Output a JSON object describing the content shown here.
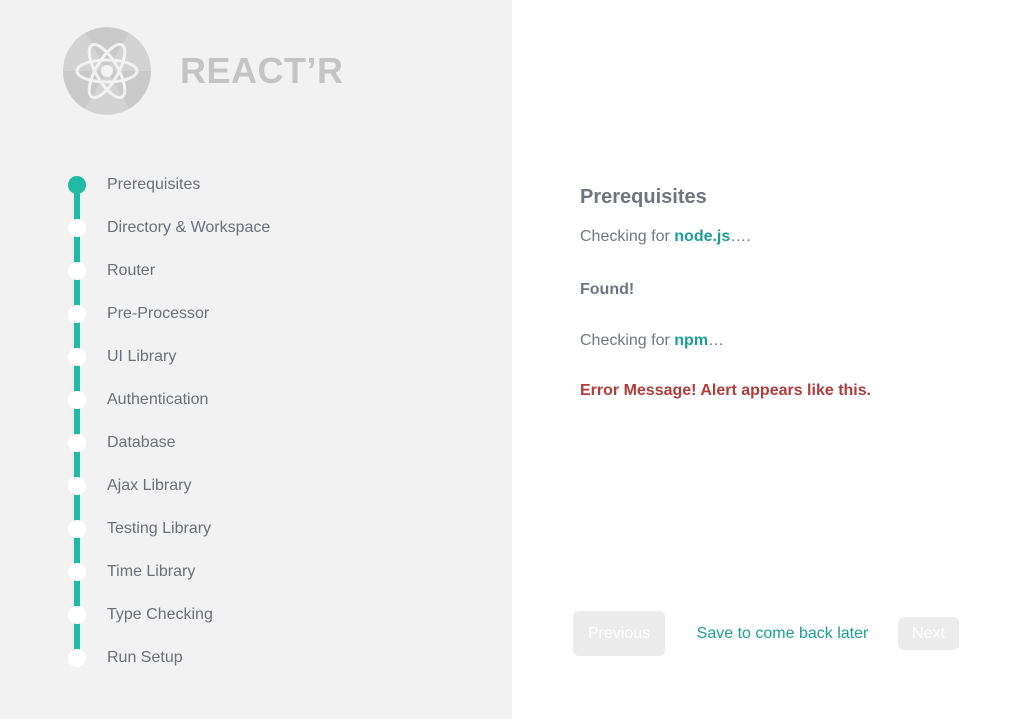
{
  "brand": {
    "name": "REACT’R",
    "logo_icon": "react-atom-radiation-icon"
  },
  "steps": [
    {
      "label": "Prerequisites",
      "active": true
    },
    {
      "label": "Directory & Workspace",
      "active": false
    },
    {
      "label": "Router",
      "active": false
    },
    {
      "label": "Pre-Processor",
      "active": false
    },
    {
      "label": "UI Library",
      "active": false
    },
    {
      "label": "Authentication",
      "active": false
    },
    {
      "label": "Database",
      "active": false
    },
    {
      "label": "Ajax Library",
      "active": false
    },
    {
      "label": "Testing Library",
      "active": false
    },
    {
      "label": "Time Library",
      "active": false
    },
    {
      "label": "Type Checking",
      "active": false
    },
    {
      "label": "Run Setup",
      "active": false
    }
  ],
  "content": {
    "title": "Prerequisites",
    "check_node_prefix": "Checking for ",
    "check_node_name": "node.js",
    "check_node_suffix": "….",
    "found": "Found!",
    "check_npm_prefix": "Checking for ",
    "check_npm_name": "npm",
    "check_npm_suffix": "…",
    "error": "Error Message! Alert appears like this."
  },
  "buttons": {
    "previous": "Previous",
    "save": "Save to come back later",
    "next": "Next"
  },
  "colors": {
    "accent": "#1fbba6",
    "accent_text": "#1c9e92",
    "error": "#b23c3c",
    "sidebar_bg": "#f2f2f2"
  }
}
